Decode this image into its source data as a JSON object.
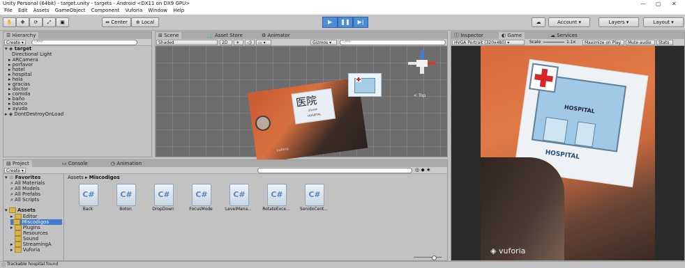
{
  "window": {
    "title": "Unity Personal (64bit) - target.unity - targets - Android <DX11 on DX9 GPU>",
    "controls": [
      "—",
      "▢",
      "✕"
    ]
  },
  "menu": [
    "File",
    "Edit",
    "Assets",
    "GameObject",
    "Component",
    "Vuforia",
    "Window",
    "Help"
  ],
  "toolbar": {
    "tools": [
      "hand",
      "move",
      "rotate",
      "scale",
      "rect"
    ],
    "pivot": "Center",
    "space": "Local",
    "play_controls": [
      "▶",
      "❚❚",
      "▶|"
    ],
    "account": "Account",
    "layers": "Layers",
    "layout": "Layout"
  },
  "hierarchy": {
    "tab": "Hierarchy",
    "create": "Create",
    "search_placeholder": "Q▾All",
    "scene_name": "target",
    "items": [
      "Directional Light",
      "ARCamera",
      "porfavor",
      "hotel",
      "hospital",
      "hola",
      "gracias",
      "doctor",
      "comida",
      "baño",
      "banco",
      "ayuda"
    ],
    "dont_destroy": "DontDestroyOnLoad"
  },
  "scene_panel": {
    "tabs": [
      "Scene",
      "Asset Store",
      "Animator"
    ],
    "shading": "Shaded",
    "mode_2d": "2D",
    "gizmos": "Gizmos",
    "search_placeholder": "Q▾All",
    "gizmo_label": "< Top",
    "card_text_cn": "医院",
    "card_text_pinyin": "yīyuàn",
    "card_text_es": "HOSPITAL",
    "card_watermark": "vuforia"
  },
  "inspector_panel": {
    "tabs": [
      "Inspector",
      "Game",
      "Services"
    ],
    "resolution": "HVGA Portrait (320x480)",
    "scale_label": "Scale",
    "scale_value": "1.1x",
    "buttons": [
      "Maximize on Play",
      "Mute audio",
      "Stats"
    ]
  },
  "game_view": {
    "sign_title": "HOSPITAL",
    "sign_caption": "HOSPITAL",
    "watermark": "vuforia"
  },
  "project": {
    "tabs": [
      "Project",
      "Console",
      "Animation"
    ],
    "create": "Create",
    "favorites_header": "Favorites",
    "favorites": [
      "All Materials",
      "All Models",
      "All Prefabs",
      "All Scripts"
    ],
    "assets_header": "Assets",
    "tree": [
      "Editor",
      "Miscodigos",
      "Plugins",
      "Resources",
      "Sound",
      "StreamingA",
      "Vuforia"
    ],
    "breadcrumb": [
      "Assets",
      "Miscodigos"
    ],
    "scripts": [
      "Back",
      "Boton",
      "DropDown",
      "FocusMode",
      "LevelMana...",
      "RotateExce...",
      "SonidoCent..."
    ],
    "script_glyph": "C#"
  },
  "status": {
    "message": "Trackable hospital found"
  },
  "colors": {
    "editor_bg": "#c2c2c2",
    "selection": "#3e7bd0",
    "play_blue": "#4d8fd6",
    "scene_bg": "#6d6d6d"
  }
}
